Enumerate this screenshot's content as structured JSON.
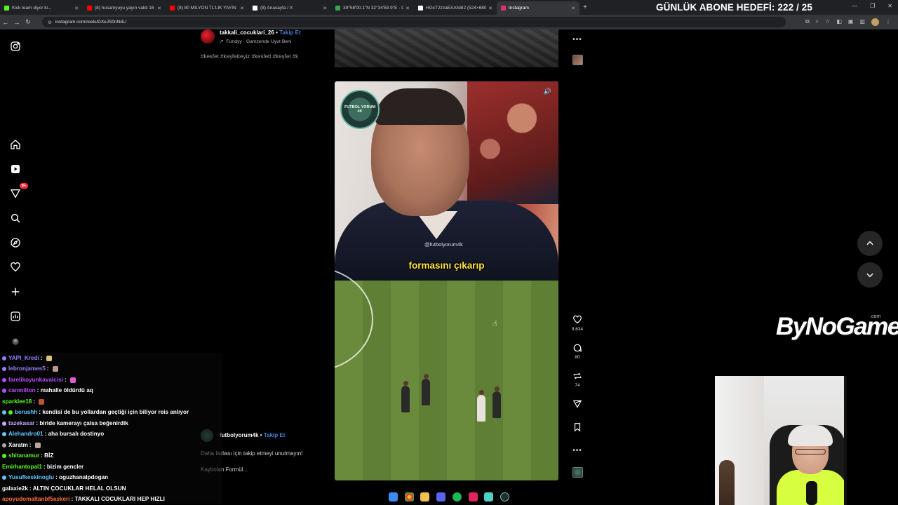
{
  "browser": {
    "tabs": [
      {
        "label": "Kick team diyor ki...",
        "color": "#53fc18"
      },
      {
        "label": "(8) husamyuyu yayın vakti 16 -",
        "color": "#ff0000"
      },
      {
        "label": "(8) 80 MİLYON TL'LİK YAYIN",
        "color": "#ff0000"
      },
      {
        "label": "(8) Anasayfa / X",
        "color": "#ffffff"
      },
      {
        "label": "39°58'00.1\"N 32°34'59.9\"E - G...",
        "color": "#34a853"
      },
      {
        "label": "HGxT2zzaEAAfoB2 (524×680)",
        "color": "#ffffff"
      },
      {
        "label": "Instagram",
        "color": "#e1306c"
      }
    ],
    "url": "instagram.com/reels/DXeJS0nNdL/",
    "goal_text": "GÜNLÜK ABONE HEDEFİ: 222 / 25"
  },
  "sidebar": {
    "notification_badge": "9+"
  },
  "previous_reel": {
    "username": "takkali_cocuklari_26",
    "separator": "•",
    "follow": "Takip Et",
    "song": "Fundyy · Gamzende Uyut Beni",
    "tags": "#kesfet #keşfetteyiz #kesfett #keşfet #k"
  },
  "reel": {
    "logo_text": "FUTBOL YORUM 4K",
    "watermark": "@futbolyorum4k",
    "subtitle": "formasını çıkarıp"
  },
  "actions": {
    "likes": "9,634",
    "comments": "80",
    "reposts": "74"
  },
  "caption": {
    "username": "futbolyorum4k",
    "separator": "•",
    "follow": "Takip Et",
    "text": "Daha fazlası için takip etmeyi unutmayın!",
    "audio": "Kaybolan Formül..."
  },
  "brand": {
    "name": "ByNoGame",
    "suffix": ".com"
  },
  "chat": [
    {
      "user": "YAPI_Kredi",
      "msg": "",
      "color": "#9b7bff"
    },
    {
      "user": "lebronjames5",
      "msg": "",
      "color": "#9b7bff"
    },
    {
      "user": "farelikoyunkavalcisi",
      "msg": "",
      "color": "#b84dff"
    },
    {
      "user": "canmilton",
      "msg": "mahalle öldürdü aq",
      "color": "#b84dff"
    },
    {
      "user": "sparklee18",
      "msg": "",
      "color": "#53fc18"
    },
    {
      "user": "berushh",
      "msg": "kendisi de bu yollardan geçtiği için biliyor reis anlıyor",
      "color": "#62c6ff"
    },
    {
      "user": "tazekasar",
      "msg": "biride kamerayı çalsa beğenirdik",
      "color": "#c6a8ff"
    },
    {
      "user": "Alehandro01",
      "msg": "aha bursalı dostinyo",
      "color": "#62c6ff"
    },
    {
      "user": "Xaratm",
      "msg": "",
      "color": "#ffffff"
    },
    {
      "user": "shitanamur",
      "msg": "BİZ",
      "color": "#53fc18"
    },
    {
      "user": "Emirhantopal1",
      "msg": "bizim gencler",
      "color": "#53fc18"
    },
    {
      "user": "Yusufkeskinoglu",
      "msg": "oguzhanalpdogan",
      "color": "#62c6ff"
    },
    {
      "user": "galaxie2k",
      "msg": "ALTIN ÇOCUKLAR HELAL OLSUN",
      "color": "#ffffff"
    },
    {
      "user": "apoyudomaltanbf5askeri",
      "msg": "TAKKALI COCUKLARI HEP HIZLI",
      "color": "#ff6a3d"
    }
  ]
}
